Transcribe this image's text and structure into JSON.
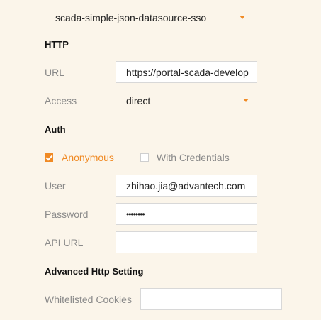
{
  "datasource": {
    "selected": "scada-simple-json-datasource-sso"
  },
  "http": {
    "section_title": "HTTP",
    "url_label": "URL",
    "url_value": "https://portal-scada-develop",
    "access_label": "Access",
    "access_value": "direct"
  },
  "auth": {
    "section_title": "Auth",
    "anonymous_label": "Anonymous",
    "anonymous_checked": true,
    "with_credentials_label": "With Credentials",
    "with_credentials_checked": false,
    "user_label": "User",
    "user_value": "zhihao.jia@advantech.com",
    "password_label": "Password",
    "password_value": "••••••••",
    "api_url_label": "API URL",
    "api_url_value": ""
  },
  "advanced": {
    "section_title": "Advanced Http Setting",
    "whitelisted_cookies_label": "Whitelisted Cookies",
    "whitelisted_cookies_value": ""
  },
  "colors": {
    "accent": "#f08a24",
    "background": "#fbf5ea",
    "label": "#8a8a8a"
  }
}
